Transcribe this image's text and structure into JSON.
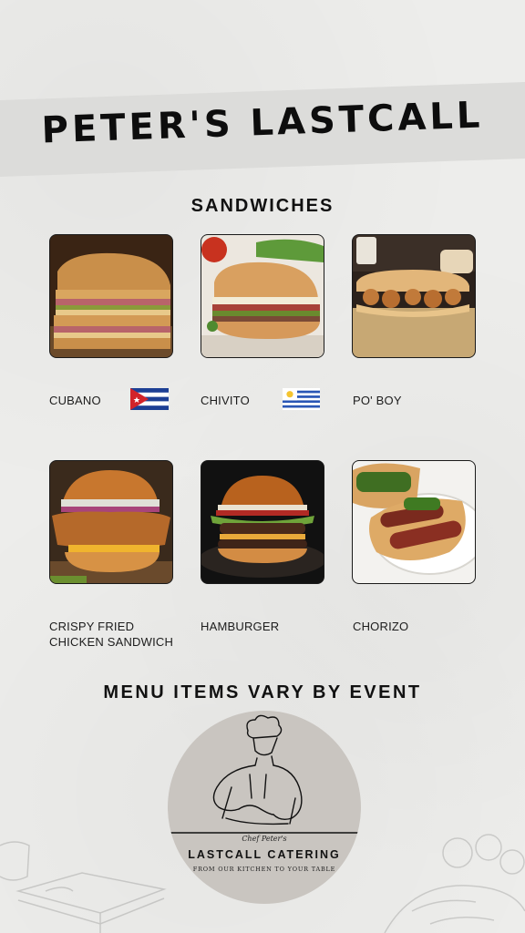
{
  "header": {
    "title": "PETER'S LASTCALL"
  },
  "sections": {
    "sandwiches": "SANDWICHES",
    "note": "MENU ITEMS VARY BY EVENT"
  },
  "items": [
    {
      "name": "CUBANO",
      "flag": "cuba-flag"
    },
    {
      "name": "CHIVITO",
      "flag": "uruguay-flag"
    },
    {
      "name": "PO' BOY",
      "flag": ""
    },
    {
      "name": "CRISPY FRIED\nCHICKEN SANDWICH",
      "flag": ""
    },
    {
      "name": "HAMBURGER",
      "flag": ""
    },
    {
      "name": "CHORIZO",
      "flag": ""
    }
  ],
  "logo": {
    "signature": "Chef Peter's",
    "name": "LASTCALL CATERING",
    "tagline": "FROM OUR KITCHEN TO YOUR TABLE"
  },
  "colors": {
    "background": "#efeeec",
    "banner": "#dcdcda",
    "logo_circle": "#c9c5c0",
    "text": "#111111"
  }
}
